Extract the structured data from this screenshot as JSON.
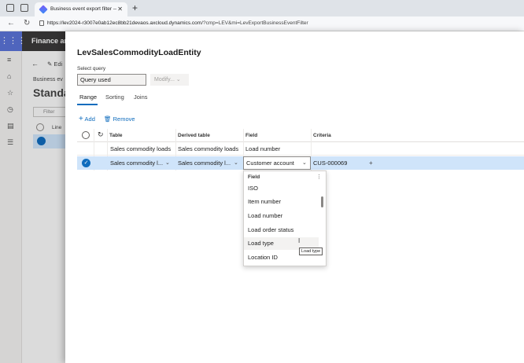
{
  "browser": {
    "tab_title": "Business event export filter -- Fin",
    "tab_close": "✕",
    "new_tab": "+",
    "url_host": "https://lev2024-r3007e0ab12ec8bb21devaos.axcloud.dynamics.com",
    "url_path": "/?cmp=LEV&mi=LevExportBusinessEventFilter"
  },
  "shell": {
    "app_name": "Finance and",
    "waffle_icon": "waffle-icon"
  },
  "background": {
    "edit_label": "Edi",
    "breadcrumb": "Business ev",
    "heading": "Standa",
    "filter_placeholder": "Filter",
    "col_line": "Line"
  },
  "panel": {
    "title": "LevSalesCommodityLoadEntity",
    "select_query_label": "Select query",
    "query_value": "Query used",
    "modify_label": "Modify...",
    "tabs": [
      "Range",
      "Sorting",
      "Joins"
    ],
    "add_label": "Add",
    "remove_label": "Remove"
  },
  "grid": {
    "headers": {
      "table": "Table",
      "derived": "Derived table",
      "field": "Field",
      "criteria": "Criteria"
    },
    "rows": [
      {
        "table": "Sales commodity loads",
        "derived": "Sales commodity loads",
        "field": "Load number",
        "criteria": ""
      },
      {
        "table": "Sales commodity l...",
        "derived": "Sales commodity l...",
        "field": "Customer account",
        "criteria": "CUS-000069"
      }
    ]
  },
  "flyout": {
    "header": "Field",
    "more": "⋮",
    "items": [
      "ISO",
      "Item number",
      "Load number",
      "Load order status",
      "Load type",
      "Location ID"
    ],
    "hovered": "Load type",
    "tooltip": "Load type"
  }
}
